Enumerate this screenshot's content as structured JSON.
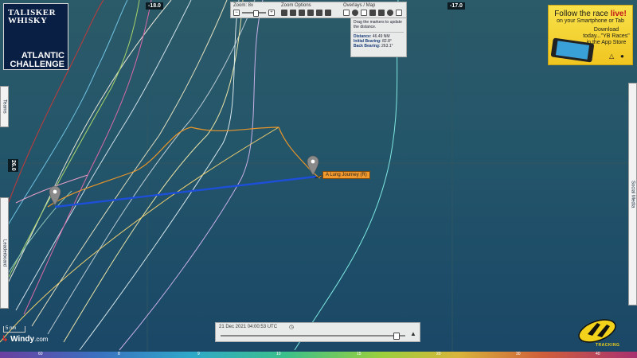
{
  "map": {
    "longitude_ticks": [
      "-18.0",
      "-17.0"
    ],
    "latitude_tick": "26.0"
  },
  "logo": {
    "brand": "TALISKER WHISKY",
    "event": "ATLANTIC CHALLENGE"
  },
  "toolbar": {
    "zoom_label": "Zoom: 8x",
    "zoom_minus": "−",
    "zoom_plus": "+",
    "zoom_level": 0.55,
    "zoom_options_label": "Zoom Options",
    "overlays_label": "Overlays / Map"
  },
  "distance_panel": {
    "instructions": "Drag the markers to update the distance.",
    "distance_label": "Distance:",
    "distance_value": "46.49 NM",
    "initial_bearing_label": "Initial Bearing:",
    "initial_bearing_value": "82.8°",
    "back_bearing_label": "Back Bearing:",
    "back_bearing_value": "263.1°"
  },
  "ad": {
    "headline": "Follow the race",
    "headline_em": "live!",
    "line2": "on your Smartphone or Tab",
    "line3": "Download today...\"YB Races\"",
    "line4": "in the App Store"
  },
  "side_tabs": {
    "teams": "Teams",
    "leaderboard": "Leaderboard",
    "social_media": "Social Media"
  },
  "boat_label": "A Lung Journey (R)",
  "timeline": {
    "timestamp": "21 Dec 2021 04:00:53 UTC",
    "position": 0.95
  },
  "scale": {
    "label": "5 nm"
  },
  "windy": {
    "text": "Windy",
    "suffix": ".com"
  },
  "windscale": {
    "ticks": [
      "60",
      "8",
      "9",
      "10",
      "15",
      "20",
      "30",
      "40",
      "60"
    ]
  },
  "tracker": {
    "brand": "TRACKING"
  },
  "colors": {
    "measure_line": "#1d4fd8",
    "boat_track": "#e8952a",
    "ad_bg": "#f5d531"
  }
}
